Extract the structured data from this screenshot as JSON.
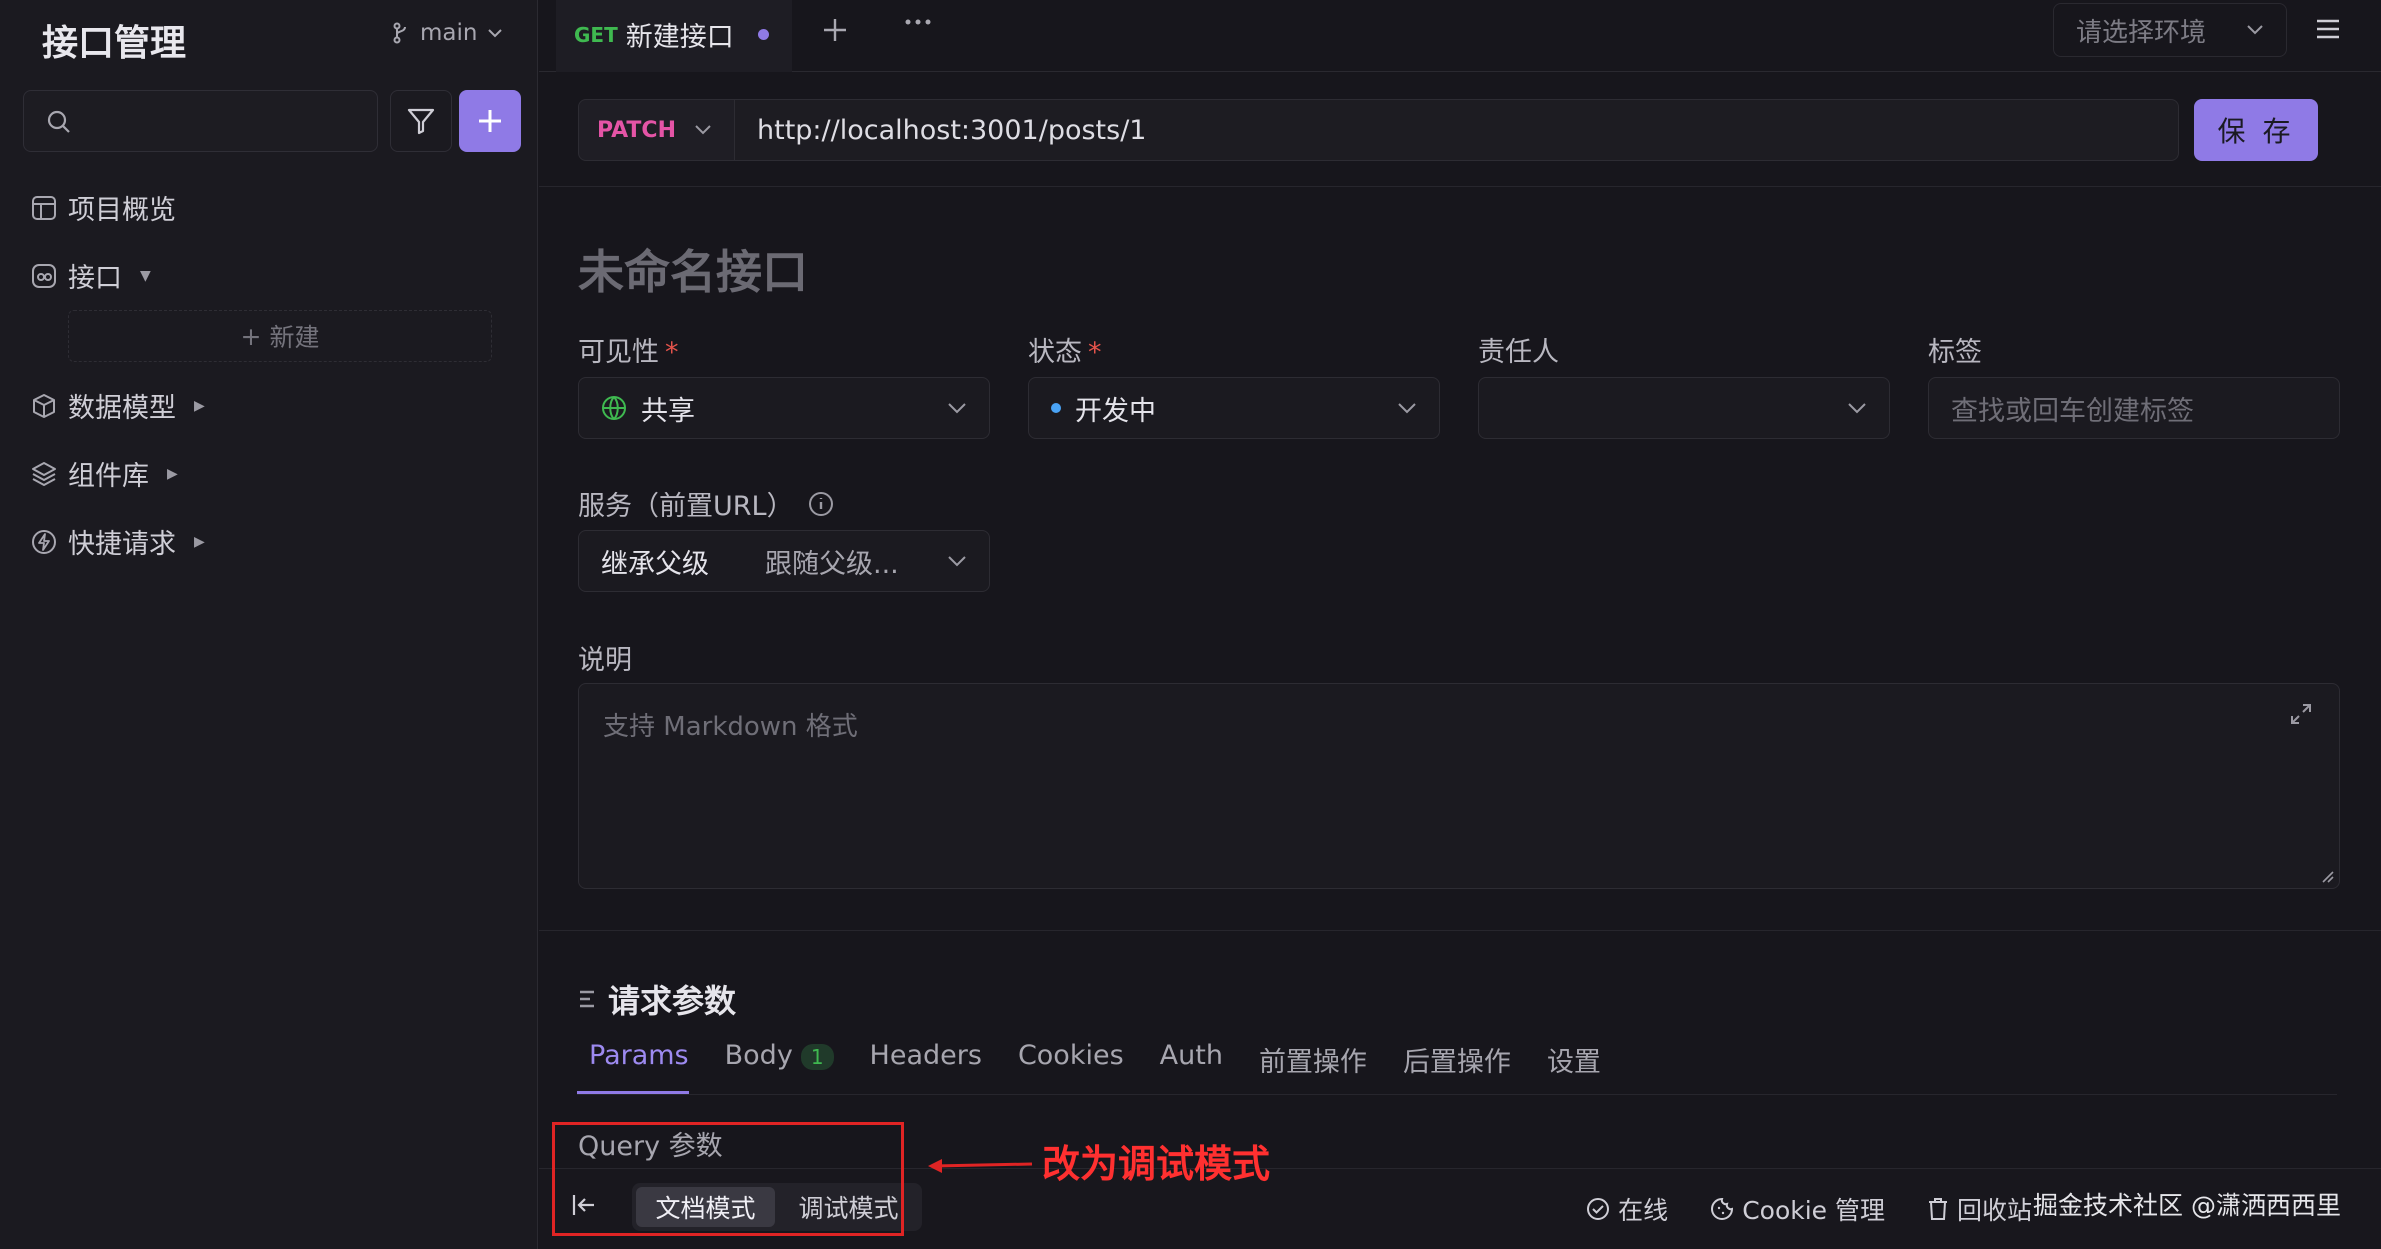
{
  "sidebar": {
    "title": "接口管理",
    "branch": "main",
    "items": [
      {
        "label": "项目概览"
      },
      {
        "label": "接口"
      },
      {
        "label": "数据模型"
      },
      {
        "label": "组件库"
      },
      {
        "label": "快捷请求"
      }
    ],
    "new_label": "新建"
  },
  "tabbar": {
    "tab": {
      "method": "GET",
      "name": "新建接口"
    },
    "env_placeholder": "请选择环境"
  },
  "request": {
    "method": "PATCH",
    "url": "http://localhost:3001/posts/1",
    "save_label": "保 存"
  },
  "form": {
    "name_placeholder": "未命名接口",
    "visibility": {
      "label": "可见性",
      "value": "共享"
    },
    "status": {
      "label": "状态",
      "value": "开发中"
    },
    "owner": {
      "label": "责任人",
      "value": ""
    },
    "tags": {
      "label": "标签",
      "placeholder": "查找或回车创建标签"
    },
    "service": {
      "label": "服务（前置URL）",
      "value": "继承父级",
      "sub": "跟随父级..."
    },
    "description": {
      "label": "说明",
      "placeholder": "支持 Markdown 格式"
    },
    "required_mark": "*"
  },
  "params": {
    "section_title": "请求参数",
    "tabs": [
      {
        "label": "Params"
      },
      {
        "label": "Body",
        "badge": "1"
      },
      {
        "label": "Headers"
      },
      {
        "label": "Cookies"
      },
      {
        "label": "Auth"
      },
      {
        "label": "前置操作"
      },
      {
        "label": "后置操作"
      },
      {
        "label": "设置"
      }
    ],
    "query_label": "Query 参数"
  },
  "bottombar": {
    "modes": [
      "文档模式",
      "调试模式"
    ],
    "online": "在线",
    "cookie": "Cookie 管理",
    "recycle": "回收站"
  },
  "annotation": {
    "text": "改为调试模式"
  },
  "watermark": "掘金技术社区 @潇洒西西里",
  "colors": {
    "accent": "#8f7ae6",
    "patch": "#e454a6",
    "get": "#3fb950",
    "annotation": "#e02424"
  }
}
